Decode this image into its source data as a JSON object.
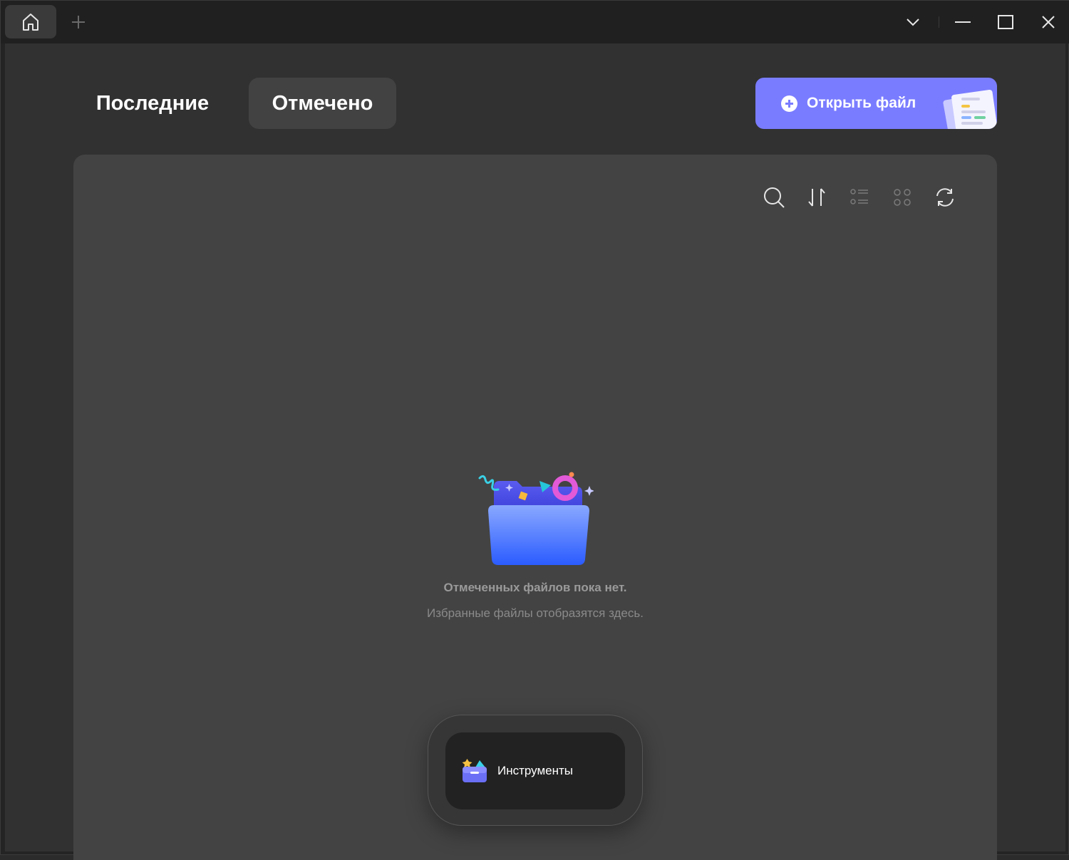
{
  "titlebar": {
    "home_icon": "home-icon",
    "add_tab_icon": "plus-icon",
    "controls": [
      "chevron-down-icon",
      "minimize-icon",
      "maximize-icon",
      "close-icon"
    ]
  },
  "tabs": {
    "recent_label": "Последние",
    "starred_label": "Отмечено",
    "active": "starred"
  },
  "open_file": {
    "label": "Открыть файл",
    "icon": "plus-circle-icon",
    "color": "#7a7cff"
  },
  "toolbar": {
    "icons": [
      "search-icon",
      "sort-icon",
      "list-view-icon",
      "grid-view-icon",
      "refresh-icon"
    ]
  },
  "empty_state": {
    "title": "Отмеченных файлов пока нет.",
    "subtitle": "Избранные файлы отобразятся здесь."
  },
  "tools": {
    "label": "Инструменты",
    "icon": "toolbox-icon"
  }
}
